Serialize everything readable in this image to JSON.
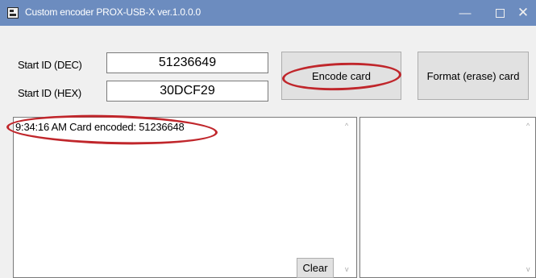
{
  "window": {
    "title": "Custom encoder PROX-USB-X ver.1.0.0.0",
    "minimize_glyph": "—",
    "close_glyph": "✕"
  },
  "start_id_dec": {
    "label": "Start ID (DEC)",
    "value": "51236649"
  },
  "start_id_hex": {
    "label": "Start ID (HEX)",
    "value": "30DCF29"
  },
  "buttons": {
    "encode": "Encode card",
    "format": "Format (erase) card",
    "clear": "Clear"
  },
  "log": {
    "lines": [
      "9:34:16 AM Card encoded: 51236648"
    ]
  },
  "scrollbar": {
    "up_glyph": "^",
    "down_glyph": "v"
  },
  "colors": {
    "titlebar": "#6c8cbf",
    "highlight": "#c0262b"
  }
}
